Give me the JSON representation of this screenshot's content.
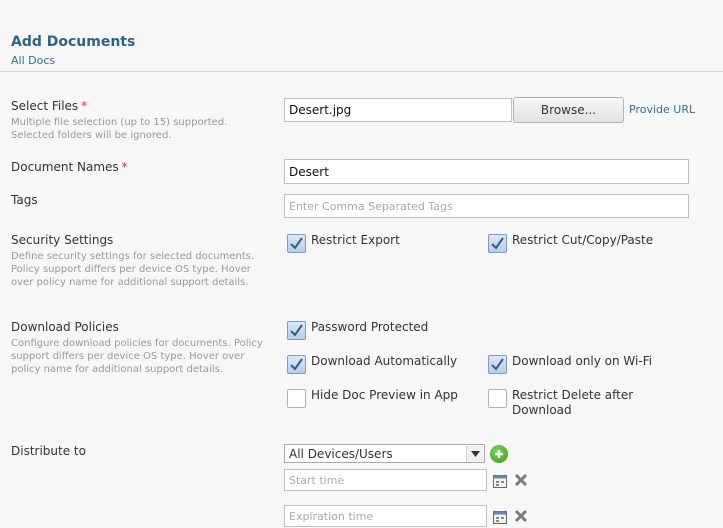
{
  "header": {
    "title": "Add Documents",
    "breadcrumb": "All Docs"
  },
  "select_files": {
    "label": "Select Files",
    "required": "*",
    "help": "Multiple file selection (up to 15) supported. Selected folders will be ignored.",
    "value": "Desert.jpg",
    "browse_label": "Browse...",
    "provide_url_label": "Provide URL"
  },
  "document_names": {
    "label": "Document Names",
    "required": "*",
    "value": "Desert"
  },
  "tags": {
    "label": "Tags",
    "placeholder": "Enter Comma Separated Tags"
  },
  "security": {
    "label": "Security Settings",
    "help": "Define security settings for selected documents. Policy support differs per device OS type. Hover over policy name for additional support details.",
    "options": [
      {
        "label": "Restrict Export",
        "checked": true
      },
      {
        "label": "Restrict Cut/Copy/Paste",
        "checked": true
      }
    ]
  },
  "download": {
    "label": "Download Policies",
    "help": "Configure download policies for documents. Policy support differs per device OS type. Hover over policy name for additional support details.",
    "options": [
      {
        "label": "Password Protected",
        "checked": true
      },
      {
        "label": "Download Automatically",
        "checked": true
      },
      {
        "label": "Download only on Wi-Fi",
        "checked": true
      },
      {
        "label": "Hide Doc Preview in App",
        "checked": false
      },
      {
        "label": "Restrict Delete after Download",
        "checked": false
      }
    ]
  },
  "distribute": {
    "label": "Distribute to",
    "selected": "All Devices/Users",
    "start_placeholder": "Start time",
    "expiration_placeholder": "Expiration time"
  },
  "colors": {
    "accent": "#2f6486",
    "link": "#2f6fa4",
    "required": "#d8302b",
    "add": "#3c9a1e"
  }
}
